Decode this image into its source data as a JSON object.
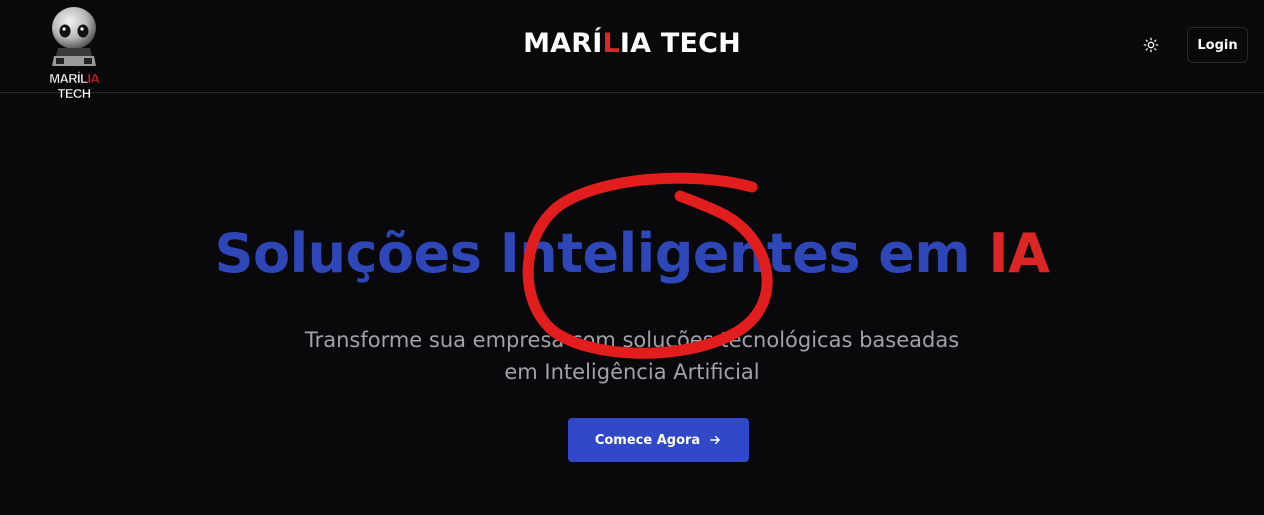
{
  "header": {
    "logo": {
      "text_main": "MARÍL",
      "text_accent": "IA",
      "text_tail": " TECH",
      "icon": "robot-head-icon"
    },
    "brand": {
      "part1": "MARÍ",
      "accent": "L",
      "part2": "IA TECH"
    },
    "theme_toggle_icon": "sun-icon",
    "login_label": "Login"
  },
  "hero": {
    "title_main": "Soluções Inteligentes em ",
    "title_accent": "IA",
    "subtitle": "Transforme sua empresa com soluções tecnológicas baseadas em Inteligência Artificial",
    "cta_label": "Comece Agora",
    "cta_icon": "arrow-right-icon"
  },
  "colors": {
    "background": "#09090b",
    "primary_blue": "#3148c8",
    "title_blue": "#2f46b8",
    "accent_red": "#dc2626",
    "annotation_red": "#e11d1d"
  }
}
